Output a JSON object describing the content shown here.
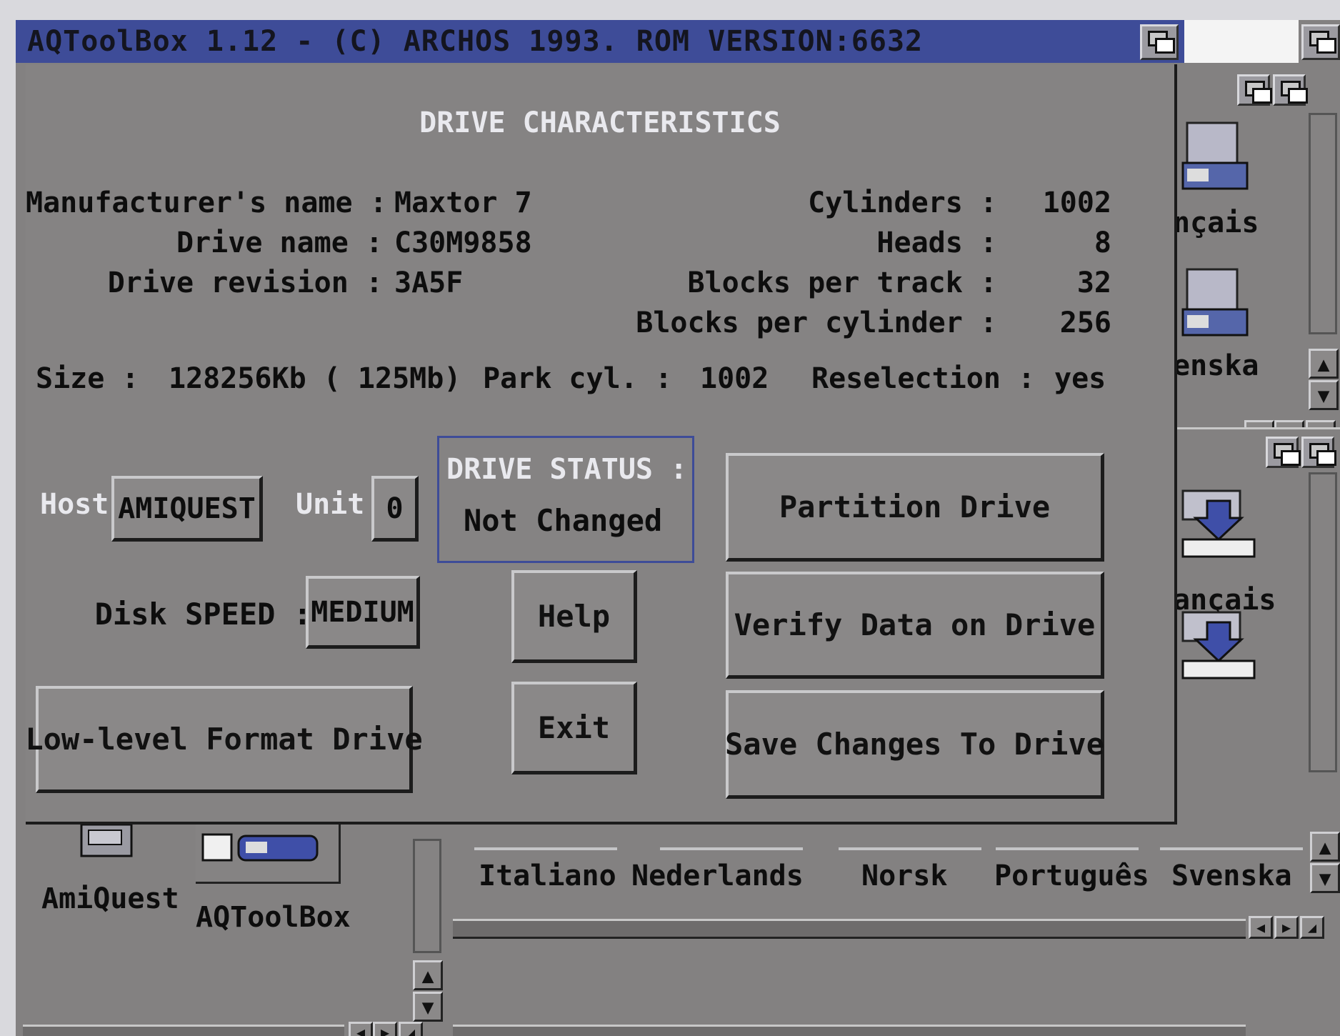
{
  "window": {
    "title": "AQToolBox 1.12 - (C) ARCHOS 1993.  ROM VERSION:6632"
  },
  "dialog": {
    "heading": "DRIVE CHARACTERISTICS",
    "manufacturer": {
      "label": "Manufacturer's name :",
      "value": "Maxtor 7"
    },
    "drive_name": {
      "label": "Drive name :",
      "value": "C30M9858"
    },
    "drive_revision": {
      "label": "Drive revision :",
      "value": "3A5F"
    },
    "cylinders": {
      "label": "Cylinders :",
      "value": "1002"
    },
    "heads": {
      "label": "Heads :",
      "value": "8"
    },
    "blocks_per_track": {
      "label": "Blocks per track :",
      "value": "32"
    },
    "blocks_per_cylinder": {
      "label": "Blocks per cylinder :",
      "value": "256"
    },
    "size": {
      "label": "Size :",
      "value": "128256Kb ( 125Mb)"
    },
    "park_cyl": {
      "label": "Park cyl. :",
      "value": "1002"
    },
    "reselection": {
      "label": "Reselection :",
      "value": "yes"
    },
    "host": {
      "label": "Host",
      "value": "AMIQUEST"
    },
    "unit": {
      "label": "Unit",
      "value": "0"
    },
    "disk_speed": {
      "label": "Disk SPEED :",
      "value": "MEDIUM"
    },
    "status": {
      "label": "DRIVE STATUS :",
      "value": "Not Changed"
    },
    "buttons": {
      "partition": "Partition Drive",
      "verify": "Verify Data on Drive",
      "save": "Save Changes To Drive",
      "help": "Help",
      "exit": "Exit",
      "lowlevel": "Low-level Format Drive"
    }
  },
  "background": {
    "right_labels": [
      "nçais",
      "enska",
      "ançais"
    ],
    "drawer_left": [
      {
        "label": "AmiQuest",
        "icon": "amiquest-drawer-icon"
      },
      {
        "label": "AQToolBox",
        "icon": "aqtoolbox-tool-icon"
      }
    ],
    "languages": [
      "Italiano",
      "Nederlands",
      "Norsk",
      "Português",
      "Svenska"
    ]
  },
  "colors": {
    "title_bar": "#3e4c98",
    "panel": "#858383",
    "highlight": "#e9e9ee"
  },
  "icons": [
    "depth-gadget-icon",
    "arrow-up-icon",
    "arrow-down-icon",
    "arrow-left-icon",
    "arrow-right-icon",
    "resize-icon",
    "disk-drive-icon",
    "locale-icon"
  ]
}
